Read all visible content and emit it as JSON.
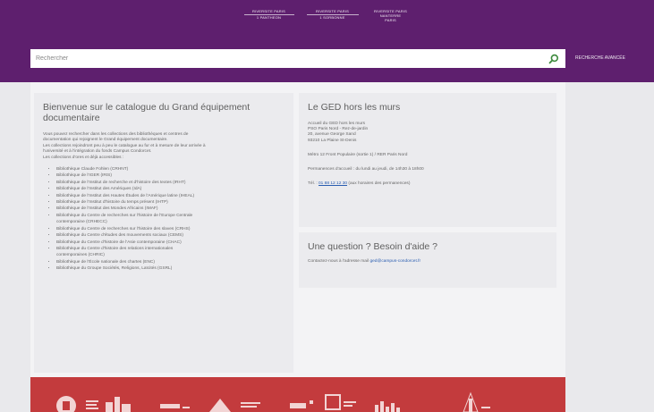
{
  "header": {
    "bg_color": "#5e1f6e",
    "logos": [
      {
        "name": "logo-universite-1",
        "lines": [
          "RIVERSITE PARIS",
          "1 PANTHEON"
        ]
      },
      {
        "name": "logo-universite-2",
        "lines": [
          "RIVERSITE PARIS",
          "1 SORBONNE"
        ]
      },
      {
        "name": "logo-universite-3",
        "lines": [
          "RIVERSITE PARIS",
          "NANTERRE",
          "PARIS"
        ]
      }
    ]
  },
  "search": {
    "placeholder": "Rechercher",
    "icon": "search-icon",
    "advanced_label": "RECHERCHE AVANCÉE"
  },
  "welcome": {
    "title": "Bienvenue sur le catalogue du Grand équipement documentaire",
    "intro": [
      "Vous pouvez rechercher dans les collections des bibliothèques et centres de",
      "documentation qui rejoignent le Grand équipement documentaire.",
      "Les collections rejoindront peu à peu le catalogue au fur et à mesure de leur arrivée à",
      "l'université et à l'intégration du fonds Campus Condorcet.",
      "Les collections d'ores et déjà accessibles :"
    ],
    "libraries": [
      "Bibliothèque Claude Fohlen (CRHNT)",
      "Bibliothèque de l'IGER (IRIS)",
      "Bibliothèque de l'Institut de recherche et d'histoire des textes (IRHT)",
      "Bibliothèque de l'Institut des Amériques (IdA)",
      "Bibliothèque de l'Institut des Hautes Études de l'Amérique latine (IHEAL)",
      "Bibliothèque de l'Institut d'histoire du temps présent (IHTP)",
      "Bibliothèque de l'Institut des Mondes Africains (IMAF)",
      "Bibliothèque du Centre de recherches sur l'histoire de l'Europe Centrale",
      "contemporaine (CRHECC)",
      "Bibliothèque du Centre de recherches sur l'histoire des slaves (CRHS)",
      "Bibliothèque du Centre d'études des mouvements sociaux (CEMS)",
      "Bibliothèque du Centre d'histoire de l'Asie contemporaine (CHAC)",
      "Bibliothèque du Centre d'histoire des relations internationales",
      "contemporaines (CHRIC)",
      "Bibliothèque de l'École nationale des chartes (ENC)",
      "Bibliothèque du Groupe Sociétés, Religions, Laïcités (GSRL)"
    ]
  },
  "hors_les_murs": {
    "title": "Le GED hors les murs",
    "address": [
      "Accueil du GED hors les murs",
      "PSO Paris Nord - Rez-de-jardin",
      "20, avenue George Sand",
      "93210 La Plaine St-Denis"
    ],
    "metro": "Métro 12 Front Populaire (sortie 1) / RER Paris Nord",
    "hours": "Permanences d'accueil : du lundi au jeudi, de 14h30 à 18h00",
    "phone_label": "Tél. :",
    "phone": "01 88 12 12 30",
    "phone_note": "(aux horaires des permanences)"
  },
  "question": {
    "title": "Une question ? Besoin d'aide ?",
    "text": "Contactez-nous à l'adresse mail",
    "email": "ged@campus-condorcet.fr"
  },
  "footer": {
    "bg_color": "#c33b3d"
  }
}
